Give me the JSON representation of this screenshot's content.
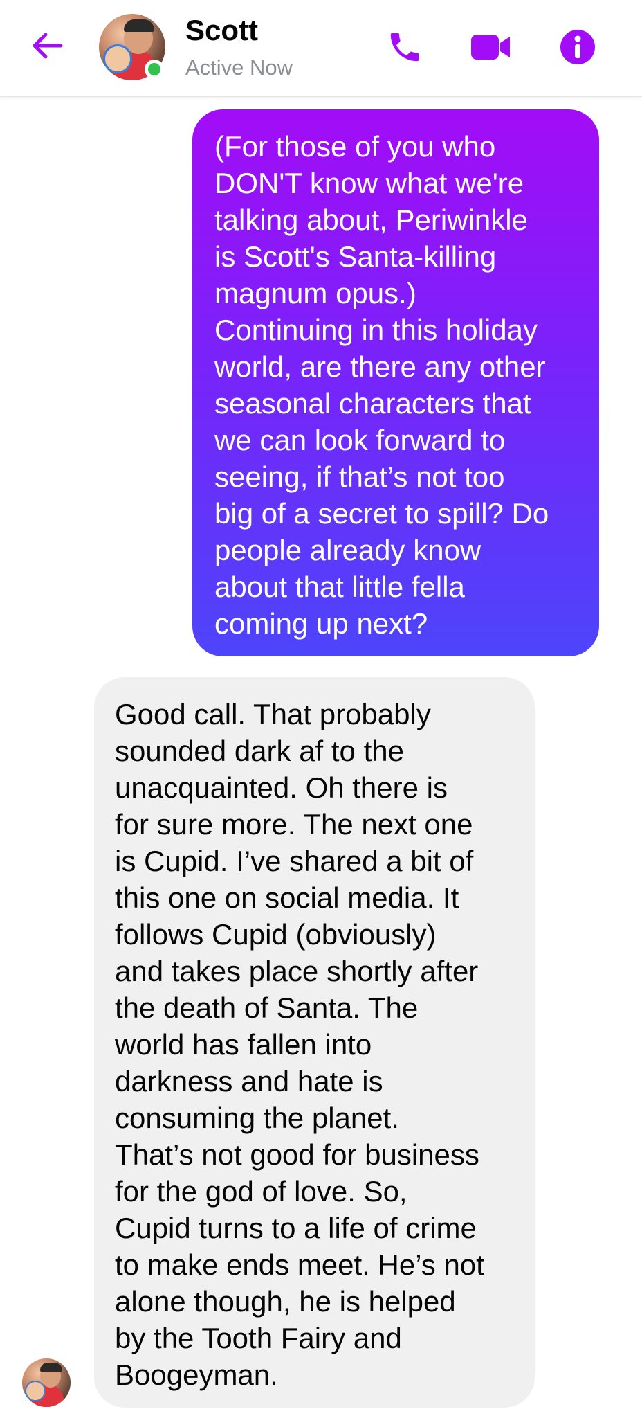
{
  "header": {
    "contact_name": "Scott",
    "contact_status": "Active Now",
    "icons": {
      "back": "back-arrow-icon",
      "call": "phone-icon",
      "video": "video-camera-icon",
      "info": "info-icon"
    },
    "accent_color": "#a20cf6",
    "online_color": "#31c24d"
  },
  "messages": [
    {
      "direction": "outgoing",
      "text": "(For those of you who\nDON'T know what we're\ntalking about, Periwinkle\nis Scott's Santa-killing\nmagnum opus.)\nContinuing in this holiday\nworld, are there any other\nseasonal characters that\nwe can look forward to\nseeing, if that’s not too\nbig of a secret to spill? Do\npeople already know\nabout that little fella\ncoming up next?",
      "gradient": [
        "#a20cf6",
        "#4d45fb"
      ]
    },
    {
      "direction": "incoming",
      "text": "Good call. That probably\nsounded dark af to the\nunacquainted. Oh there is\nfor sure more. The next one\nis Cupid. I’ve shared a bit of\nthis one on social media. It\nfollows Cupid (obviously)\nand takes place shortly after\nthe death of Santa. The\nworld has fallen into\ndarkness and hate is\nconsuming the planet.\nThat’s not good for business\nfor the god of love. So,\nCupid turns to a life of crime\nto make ends meet. He’s not\nalone though, he is helped\nby the Tooth Fairy and\nBoogeyman.",
      "bubble_color": "#f0f0f0"
    }
  ]
}
